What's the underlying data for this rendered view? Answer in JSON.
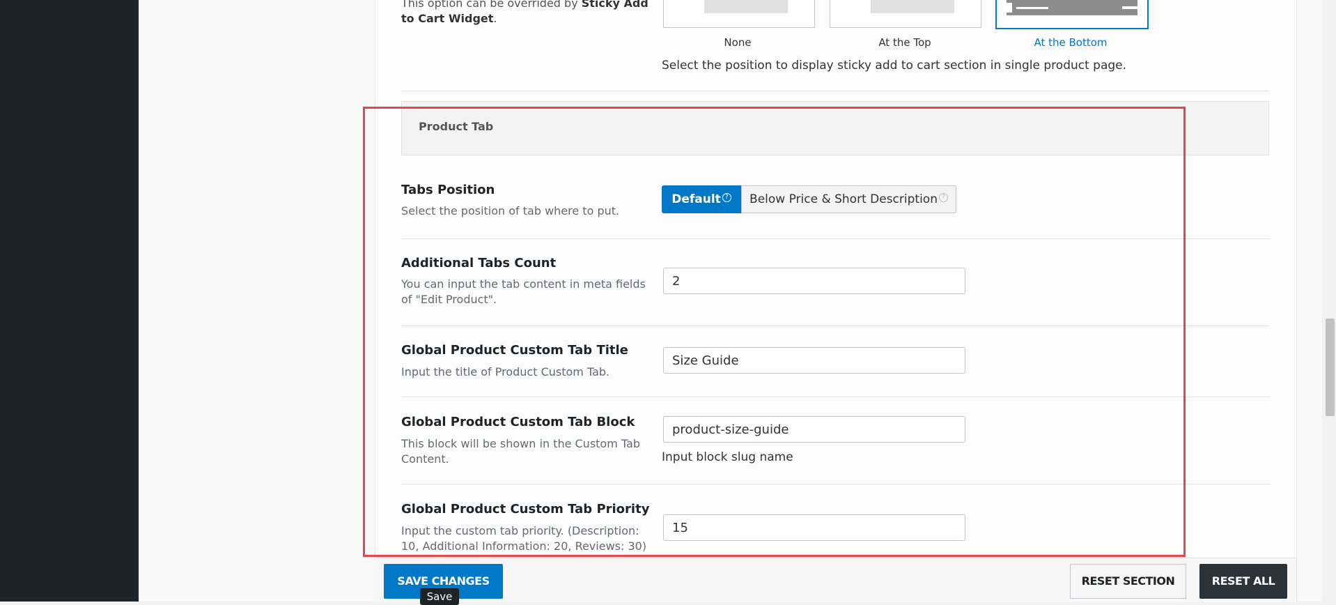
{
  "sticky_section": {
    "desc_prefix": "This option can be overrided by ",
    "desc_bold": "Sticky Add to Cart Widget",
    "desc_suffix": ".",
    "options": [
      "None",
      "At the Top",
      "At the Bottom"
    ],
    "selected": "At the Bottom",
    "help": "Select the position to display sticky add to cart section in single product page."
  },
  "product_tab": {
    "title": "Product Tab",
    "tabs_position": {
      "label": "Tabs Position",
      "desc": "Select the position of tab where to put.",
      "options": [
        "Default",
        "Below Price & Short Description"
      ],
      "selected": "Default"
    },
    "additional_tabs_count": {
      "label": "Additional Tabs Count",
      "desc": "You can input the tab content in meta fields of \"Edit Product\".",
      "value": "2"
    },
    "custom_tab_title": {
      "label": "Global Product Custom Tab Title",
      "desc": "Input the title of Product Custom Tab.",
      "value": "Size Guide"
    },
    "custom_tab_block": {
      "label": "Global Product Custom Tab Block",
      "desc": "This block will be shown in the Custom Tab Content.",
      "value": "product-size-guide",
      "hint": "Input block slug name"
    },
    "custom_tab_priority": {
      "label": "Global Product Custom Tab Priority",
      "desc": "Input the custom tab priority. (Description: 10, Additional Information: 20, Reviews: 30)",
      "value": "15"
    }
  },
  "footer": {
    "save": "SAVE CHANGES",
    "save_tooltip": "Save",
    "reset_section": "RESET SECTION",
    "reset_all": "RESET ALL"
  },
  "icons": {
    "help": "question-circle-icon"
  },
  "colors": {
    "primary": "#0078c8",
    "highlight_border": "#e8474a",
    "admin_dark": "#1d2327"
  }
}
